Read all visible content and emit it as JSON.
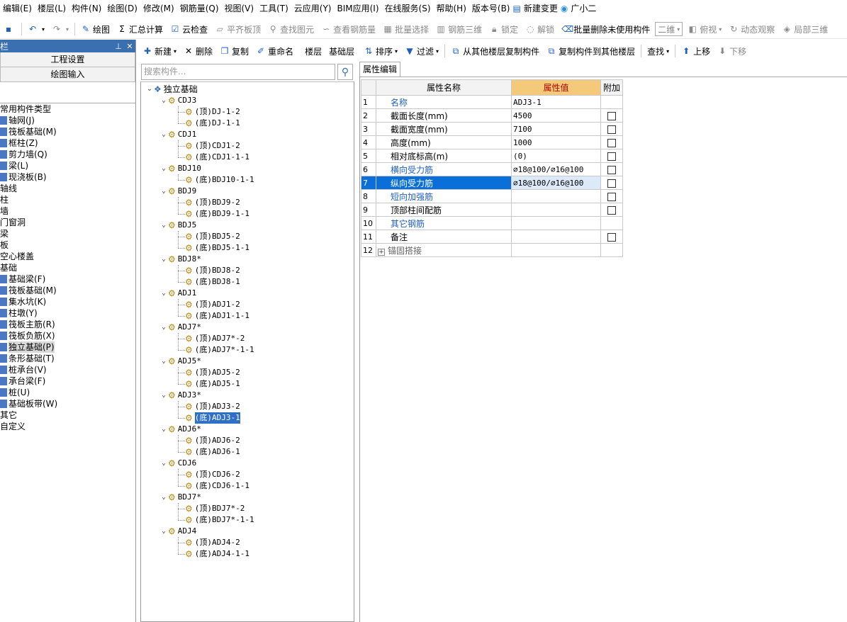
{
  "menu": [
    "编辑(E)",
    "楼层(L)",
    "构件(N)",
    "绘图(D)",
    "修改(M)",
    "钢筋量(Q)",
    "视图(V)",
    "工具(T)",
    "云应用(Y)",
    "BIM应用(I)",
    "在线服务(S)",
    "帮助(H)",
    "版本号(B)",
    "新建变更",
    "广小二"
  ],
  "toolbar": {
    "draw": "绘图",
    "sum_calc": "汇总计算",
    "cloud_check": "云检查",
    "flat_board": "平齐板顶",
    "find_elem": "查找图元",
    "view_rebar_qty": "查看钢筋量",
    "batch_select": "批量选择",
    "rebar_3d": "钢筋三维",
    "lock": "锁定",
    "unlock": "解锁",
    "batch_delete": "批量删除未使用构件",
    "view_mode": "二维",
    "top_view": "俯视",
    "dyn_view": "动态观察",
    "local_3d": "局部三维"
  },
  "left_panel": {
    "title": "栏",
    "btn_project": "工程设置",
    "btn_draw": "绘图输入",
    "tree": [
      {
        "label": "常用构件类型",
        "indent": 0,
        "icon": false
      },
      {
        "label": "轴网(J)",
        "indent": 1,
        "icon": true
      },
      {
        "label": "筏板基础(M)",
        "indent": 1,
        "icon": true
      },
      {
        "label": "框柱(Z)",
        "indent": 1,
        "icon": true
      },
      {
        "label": "剪力墙(Q)",
        "indent": 1,
        "icon": true
      },
      {
        "label": "梁(L)",
        "indent": 1,
        "icon": true
      },
      {
        "label": "现浇板(B)",
        "indent": 1,
        "icon": true
      },
      {
        "label": "轴线",
        "indent": 0,
        "icon": false
      },
      {
        "label": "柱",
        "indent": 0,
        "icon": false
      },
      {
        "label": "墙",
        "indent": 0,
        "icon": false
      },
      {
        "label": "门窗洞",
        "indent": 0,
        "icon": false
      },
      {
        "label": "梁",
        "indent": 0,
        "icon": false
      },
      {
        "label": "板",
        "indent": 0,
        "icon": false
      },
      {
        "label": "空心楼盖",
        "indent": 0,
        "icon": false
      },
      {
        "label": "基础",
        "indent": 0,
        "icon": false
      },
      {
        "label": "基础梁(F)",
        "indent": 1,
        "icon": true
      },
      {
        "label": "筏板基础(M)",
        "indent": 1,
        "icon": true
      },
      {
        "label": "集水坑(K)",
        "indent": 1,
        "icon": true
      },
      {
        "label": "柱墩(Y)",
        "indent": 1,
        "icon": true
      },
      {
        "label": "筏板主筋(R)",
        "indent": 1,
        "icon": true
      },
      {
        "label": "筏板负筋(X)",
        "indent": 1,
        "icon": true
      },
      {
        "label": "独立基础(P)",
        "indent": 1,
        "icon": true,
        "selected": true
      },
      {
        "label": "条形基础(T)",
        "indent": 1,
        "icon": true
      },
      {
        "label": "桩承台(V)",
        "indent": 1,
        "icon": true
      },
      {
        "label": "承台梁(F)",
        "indent": 1,
        "icon": true
      },
      {
        "label": "桩(U)",
        "indent": 1,
        "icon": true
      },
      {
        "label": "基础板带(W)",
        "indent": 1,
        "icon": true
      },
      {
        "label": "其它",
        "indent": 0,
        "icon": false
      },
      {
        "label": "自定义",
        "indent": 0,
        "icon": false
      }
    ]
  },
  "mid_toolbar": {
    "new": "新建",
    "delete": "删除",
    "copy": "复制",
    "rename": "重命名",
    "floor_label": "楼层",
    "floor_value": "基础层"
  },
  "search": {
    "placeholder": "搜索构件..."
  },
  "comp_tree": {
    "root": "独立基础",
    "groups": [
      {
        "name": "CDJ3",
        "children": [
          "(顶)DJ-1-2",
          "(底)DJ-1-1"
        ]
      },
      {
        "name": "CDJ1",
        "children": [
          "(顶)CDJ1-2",
          "(底)CDJ1-1-1"
        ]
      },
      {
        "name": "BDJ10",
        "children": [
          "(底)BDJ10-1-1"
        ]
      },
      {
        "name": "BDJ9",
        "children": [
          "(顶)BDJ9-2",
          "(底)BDJ9-1-1"
        ]
      },
      {
        "name": "BDJ5",
        "children": [
          "(顶)BDJ5-2",
          "(底)BDJ5-1-1"
        ]
      },
      {
        "name": "BDJ8*",
        "children": [
          "(顶)BDJ8-2",
          "(底)BDJ8-1"
        ]
      },
      {
        "name": "ADJ1",
        "children": [
          "(顶)ADJ1-2",
          "(底)ADJ1-1-1"
        ]
      },
      {
        "name": "ADJ7*",
        "children": [
          "(顶)ADJ7*-2",
          "(底)ADJ7*-1-1"
        ]
      },
      {
        "name": "ADJ5*",
        "children": [
          "(顶)ADJ5-2",
          "(底)ADJ5-1"
        ]
      },
      {
        "name": "ADJ3*",
        "children": [
          "(顶)ADJ3-2",
          "(底)ADJ3-1"
        ]
      },
      {
        "name": "ADJ6*",
        "children": [
          "(顶)ADJ6-2",
          "(底)ADJ6-1"
        ]
      },
      {
        "name": "CDJ6",
        "children": [
          "(顶)CDJ6-2",
          "(底)CDJ6-1-1"
        ]
      },
      {
        "name": "BDJ7*",
        "children": [
          "(顶)BDJ7*-2",
          "(底)BDJ7*-1-1"
        ]
      },
      {
        "name": "ADJ4",
        "children": [
          "(顶)ADJ4-2",
          "(底)ADJ4-1-1"
        ]
      }
    ],
    "selected": "(底)ADJ3-1"
  },
  "right_toolbar": {
    "sort": "排序",
    "filter": "过滤",
    "copy_from": "从其他楼层复制构件",
    "copy_to": "复制构件到其他楼层",
    "find": "查找",
    "move_up": "上移",
    "move_down": "下移"
  },
  "prop_tab": "属性编辑",
  "prop_headers": [
    "属性名称",
    "属性值",
    "附加"
  ],
  "props": [
    {
      "n": "1",
      "name": "名称",
      "value": "ADJ3-1",
      "color": "blue",
      "cb": false
    },
    {
      "n": "2",
      "name": "截面长度(mm)",
      "value": "4500",
      "color": "black",
      "cb": true
    },
    {
      "n": "3",
      "name": "截面宽度(mm)",
      "value": "7100",
      "color": "black",
      "cb": true
    },
    {
      "n": "4",
      "name": "高度(mm)",
      "value": "1000",
      "color": "black",
      "cb": true
    },
    {
      "n": "5",
      "name": "相对底标高(m)",
      "value": "(0)",
      "color": "black",
      "cb": true
    },
    {
      "n": "6",
      "name": "横向受力筋",
      "value": "⌀18@100/⌀16@100",
      "color": "blue",
      "cb": true
    },
    {
      "n": "7",
      "name": "纵向受力筋",
      "value": "⌀18@100/⌀16@100",
      "color": "blue",
      "cb": true,
      "selected": true
    },
    {
      "n": "8",
      "name": "短向加强筋",
      "value": "",
      "color": "blue",
      "cb": true
    },
    {
      "n": "9",
      "name": "顶部柱间配筋",
      "value": "",
      "color": "black",
      "cb": true
    },
    {
      "n": "10",
      "name": "其它钢筋",
      "value": "",
      "color": "blue",
      "cb": false
    },
    {
      "n": "11",
      "name": "备注",
      "value": "",
      "color": "black",
      "cb": true
    },
    {
      "n": "12",
      "name": "锚固搭接",
      "value": "",
      "color": "gray",
      "cb": false,
      "expand": true
    }
  ]
}
